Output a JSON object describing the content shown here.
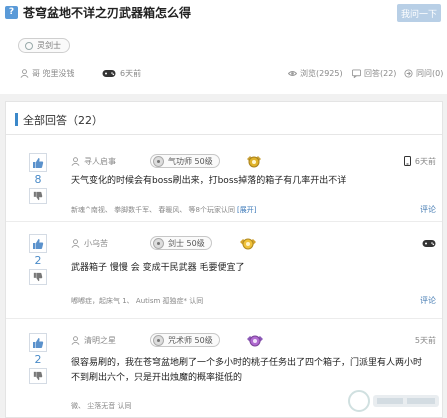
{
  "question": {
    "title": "苍穹盆地不详之刃武器箱怎么得",
    "ask_button": "我问一下",
    "tag": "灵剑士",
    "asker": "哥 兜里没钱",
    "time": "6天前",
    "views": "浏览(2925)",
    "answers_count": "回答(22)",
    "share": "同问(0)"
  },
  "answers_panel": {
    "title": "全部回答（22）"
  },
  "answers": [
    {
      "votes": "8",
      "user": "寻人启事",
      "level": "气功师 50级",
      "time": "6天前",
      "text_lines": [
        "天气变化的时候会有boss刷出来，打boss掉落的箱子有几率开出不详"
      ],
      "foot": "新魂^南视、 拳脚数千军、 春暖风、 等8个玩家认同",
      "foot_more": "[展开]",
      "comment": "评论",
      "badge_color": "#e0b32a",
      "platform": "mobile"
    },
    {
      "votes": "2",
      "user": "小乌苦",
      "level": "剑士 50级",
      "time": "",
      "text_lines": [
        "武器箱子 慢慢 会 变成干民武器 毛要便宜了"
      ],
      "foot": "嘟嘟症，起床气 1、 Autism 孤独症*  认同",
      "foot_more": "",
      "comment": "评论",
      "badge_color": "#e8b42a",
      "platform": "gamepad"
    },
    {
      "votes": "2",
      "user": "清明之星",
      "level": "咒术师 50级",
      "time": "5天前",
      "text_lines": [
        "很容易刷的，我在苍穹盆地刷了一个多小时的桃子任务出了四个箱子，门派里有人两小时",
        "不到刷出六个，只是开出烛魔的概率挺低的"
      ],
      "foot": "微、 尘落无音  认同",
      "foot_more": "",
      "comment": "评论",
      "badge_color": "#b06ad0",
      "platform": ""
    }
  ],
  "colors": {
    "accent": "#3b88c9",
    "vote_blue": "#4a8bc8",
    "button_disabled": "#b8cfe6"
  }
}
